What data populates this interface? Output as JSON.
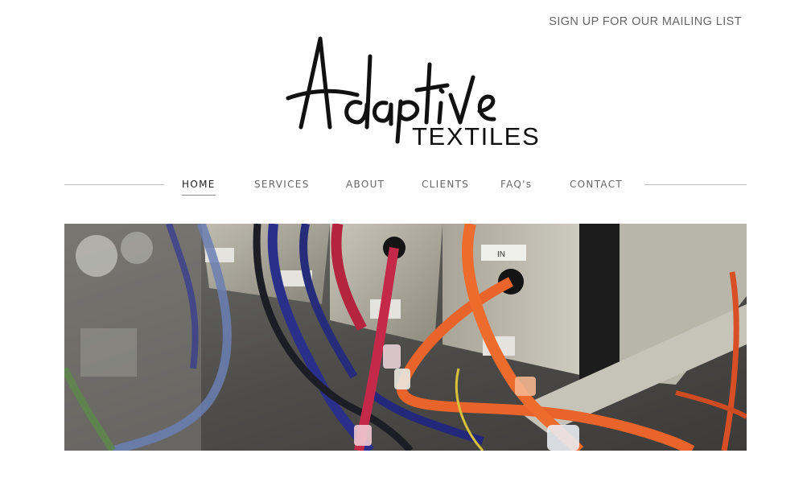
{
  "header": {
    "mailing_link": "SIGN UP FOR OUR MAILING LIST",
    "logo_script": "Adaptive",
    "logo_sub": "TEXTILES"
  },
  "nav": {
    "items": [
      {
        "label": "HOME",
        "active": true
      },
      {
        "label": "SERVICES",
        "active": false
      },
      {
        "label": "ABOUT",
        "active": false
      },
      {
        "label": "CLIENTS",
        "active": false
      },
      {
        "label": "FAQ's",
        "active": false
      },
      {
        "label": "CONTACT",
        "active": false
      }
    ]
  },
  "hero": {
    "label_in": "IN",
    "palette": {
      "orange": "#e8642a",
      "red": "#b5243f",
      "blue": "#2a2f8a",
      "steel": "#a9a59a"
    }
  }
}
